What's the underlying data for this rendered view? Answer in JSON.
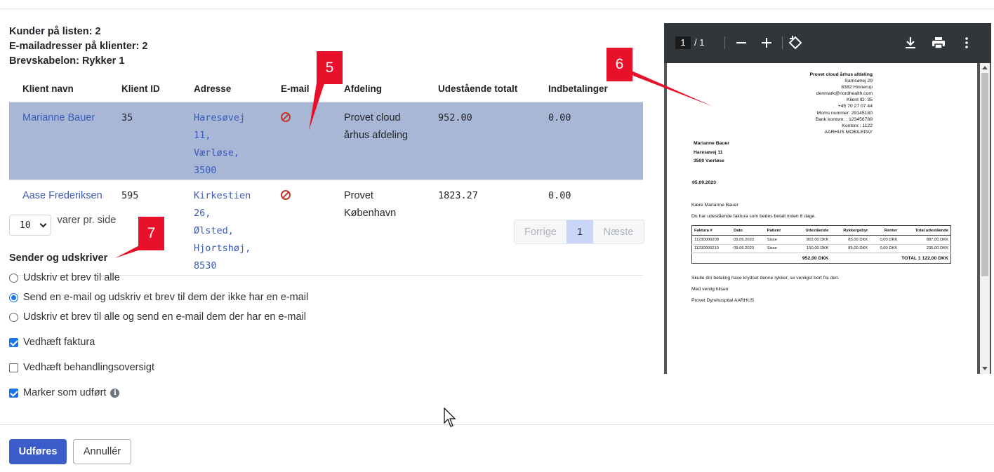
{
  "summary": {
    "line1": "Kunder på listen: 2",
    "line2": "E-mailadresser på klienter: 2",
    "line3": "Brevskabelon: Rykker 1"
  },
  "table": {
    "headers": [
      "Klient navn",
      "Klient ID",
      "Adresse",
      "E-mail",
      "Afdeling",
      "Udestående totalt",
      "Indbetalinger"
    ],
    "rows": [
      {
        "name": "Marianne Bauer",
        "id": "35",
        "address1": "Haresøvej 11,",
        "address2": "Værløse, 3500",
        "email_icon": "no-email-icon",
        "dept1": "Provet cloud",
        "dept2": "århus afdeling",
        "outstanding": "952.00",
        "payments": "0.00"
      },
      {
        "name": "Aase Frederiksen",
        "id": "595",
        "address1": "Kirkestien 26,",
        "address2": "Ølsted,",
        "address3": "Hjortshøj, 8530",
        "email_icon": "no-email-icon",
        "dept1": "Provet",
        "dept2": "København",
        "outstanding": "1823.27",
        "payments": "0.00"
      }
    ]
  },
  "pager": {
    "per_page_value": "10",
    "per_page_label": "varer pr. side",
    "prev": "Forrige",
    "current": "1",
    "next": "Næste"
  },
  "sender": {
    "title": "Sender og udskriver",
    "options": [
      {
        "label": "Udskriv et brev til alle",
        "selected": false
      },
      {
        "label": "Send en e-mail og udskriv et brev til dem der ikke har en e-mail",
        "selected": true
      },
      {
        "label": "Udskriv et brev til alle og send en e-mail dem der har en e-mail",
        "selected": false
      }
    ],
    "checkboxes": [
      {
        "label": "Vedhæft faktura",
        "checked": true
      },
      {
        "label": "Vedhæft behandlingsoversigt",
        "checked": false
      },
      {
        "label": "Marker som udført",
        "checked": true
      }
    ]
  },
  "buttons": {
    "submit": "Udføres",
    "cancel": "Annullér"
  },
  "pdf": {
    "page_current": "1",
    "page_sep_total": "/  1",
    "company": {
      "name": "Provet cloud århus afdeling",
      "street": "Samsøvej 29",
      "city": "8382 Hinnerup",
      "email": "denmark@nordhealth.com",
      "client_id": "Klient ID: 35",
      "phone": "+45 70 27 07 44",
      "vat": "Moms nummer: 29145180",
      "bank": "Bank kontonr. : 123456789",
      "account": "Kontonr.: 1122",
      "mobilepay": "AARHUS MOBILEPAY"
    },
    "recipient": {
      "name": "Marianne Bauer",
      "street": "Haresøvej 11",
      "city": "3500 Værløse"
    },
    "date": "05.09.2023",
    "greeting": "Kære Marianne Bauer",
    "intro": "Du har udestående faktura som bedes betalt inden 8 dage.",
    "table_headers": [
      "Faktura #",
      "Dato",
      "Patient",
      "Udestående",
      "Rykkergebyr",
      "Renter",
      "Total udestående"
    ],
    "table_rows": [
      [
        "11230000208",
        "09.06.2023",
        "Sisse",
        "802,00 DKK",
        "85,00 DKK",
        "0,00 DKK",
        "887,00 DKK"
      ],
      [
        "11230000210",
        "09.06.2023",
        "Sisse",
        "150,00 DKK",
        "85,00 DKK",
        "0,00 DKK",
        "235,00 DKK"
      ]
    ],
    "total_outstanding": "952,00 DKK",
    "grand_total": "TOTAL 1 122,00 DKK",
    "closing": "Skulle din betaling have krydset denne rykker, se venligst bort fra den.",
    "regards": "Med venlig hilsen",
    "signature": "Provet Dyrehospital AARHUS"
  },
  "badges": {
    "b5": "5",
    "b6": "6",
    "b7": "7"
  },
  "colors": {
    "accent": "#3c5ccc",
    "selected_row": "#a9b7d6",
    "badge": "#e8102b",
    "link": "#3b5bb8"
  }
}
